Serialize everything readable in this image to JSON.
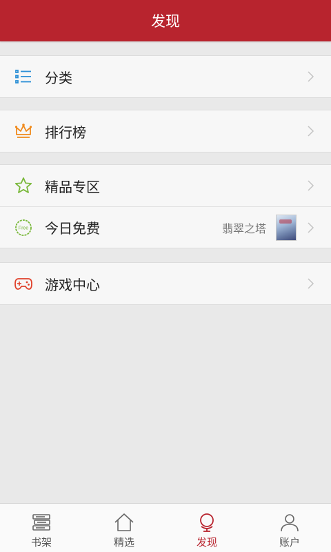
{
  "header": {
    "title": "发现"
  },
  "menu": {
    "category": "分类",
    "ranking": "排行榜",
    "premium": "精品专区",
    "free_today": "今日免费",
    "free_book_title": "翡翠之塔",
    "free_badge": "Free",
    "games": "游戏中心"
  },
  "tabs": {
    "bookshelf": "书架",
    "featured": "精选",
    "discover": "发现",
    "account": "账户"
  },
  "colors": {
    "accent": "#b8242e",
    "list_icon": "#2b8fd6",
    "crown_icon": "#f08a1c",
    "star_icon": "#79b83a",
    "free_icon": "#79b83a",
    "game_icon": "#e0402a"
  }
}
